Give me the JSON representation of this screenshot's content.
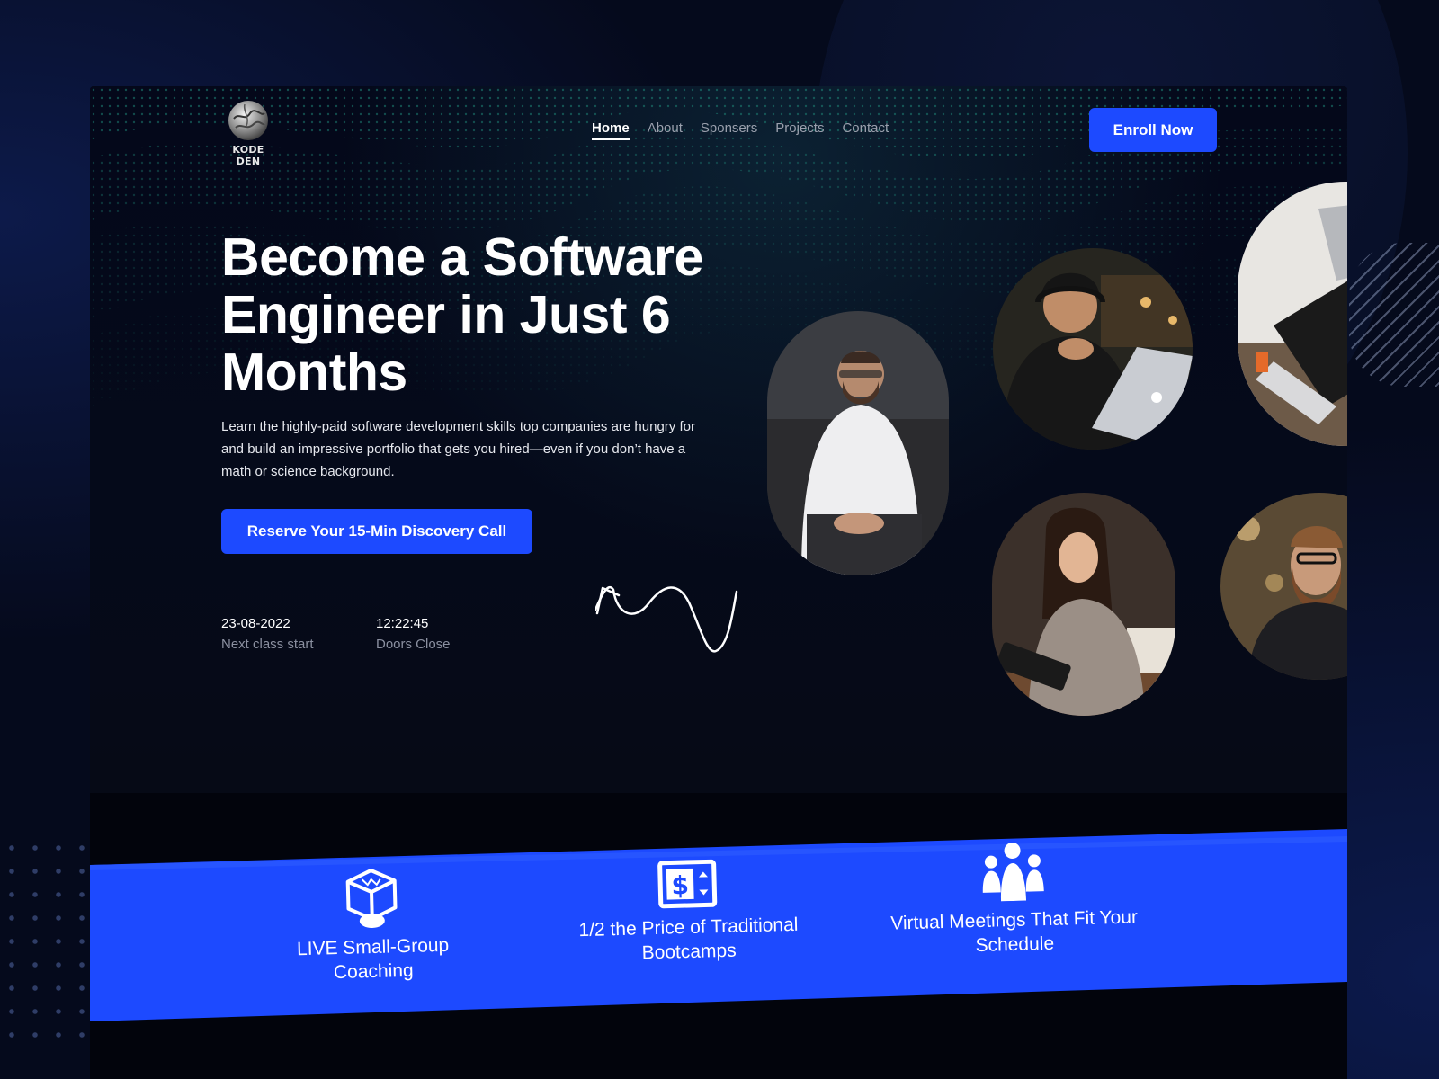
{
  "brand": {
    "name": "KODE DEN"
  },
  "nav": {
    "items": [
      {
        "label": "Home",
        "active": true
      },
      {
        "label": "About",
        "active": false
      },
      {
        "label": "Sponsers",
        "active": false
      },
      {
        "label": "Projects",
        "active": false
      },
      {
        "label": "Contact",
        "active": false
      }
    ],
    "enroll_label": "Enroll Now"
  },
  "hero": {
    "title": "Become a Software Engineer in Just 6 Months",
    "description": "Learn the highly-paid software development skills top companies are hungry for and build an impressive portfolio that gets you hired—even if you don’t have a math or science background.",
    "cta_label": "Reserve Your 15-Min Discovery Call",
    "stats": [
      {
        "value": "23-08-2022",
        "label": "Next class start"
      },
      {
        "value": "12:22:45",
        "label": "Doors Close"
      }
    ]
  },
  "features": [
    {
      "icon": "box-icon",
      "label": "LIVE Small-Group Coaching"
    },
    {
      "icon": "price-tag-icon",
      "label": "1/2 the Price of Traditional Bootcamps"
    },
    {
      "icon": "group-icon",
      "label": "Virtual Meetings That Fit Your Schedule"
    }
  ],
  "colors": {
    "accent": "#1d4aff",
    "background": "#02040c",
    "muted": "#8b90a0"
  }
}
